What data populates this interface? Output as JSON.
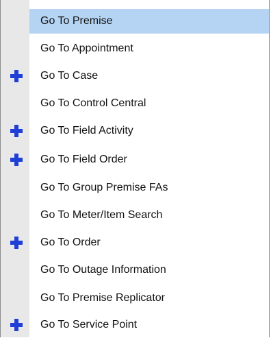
{
  "menu": {
    "items": [
      {
        "label": "Go To Premise",
        "selected": true,
        "icon": null
      },
      {
        "label": "Go To Appointment",
        "selected": false,
        "icon": null
      },
      {
        "label": "Go To Case",
        "selected": false,
        "icon": "plus-icon"
      },
      {
        "label": "Go To Control Central",
        "selected": false,
        "icon": null
      },
      {
        "label": "Go To Field Activity",
        "selected": false,
        "icon": "plus-icon"
      },
      {
        "label": "Go To Field Order",
        "selected": false,
        "icon": "plus-icon"
      },
      {
        "label": "Go To Group Premise FAs",
        "selected": false,
        "icon": null
      },
      {
        "label": "Go To Meter/Item Search",
        "selected": false,
        "icon": null
      },
      {
        "label": "Go To Order",
        "selected": false,
        "icon": "plus-icon"
      },
      {
        "label": "Go To Outage Information",
        "selected": false,
        "icon": null
      },
      {
        "label": "Go To Premise Replicator",
        "selected": false,
        "icon": null
      },
      {
        "label": "Go To Service Point",
        "selected": false,
        "icon": "plus-icon"
      }
    ]
  },
  "colors": {
    "highlight": "#b5d3f2",
    "gutter": "#e8e8e8",
    "plus_icon": "#1f3fd6"
  }
}
